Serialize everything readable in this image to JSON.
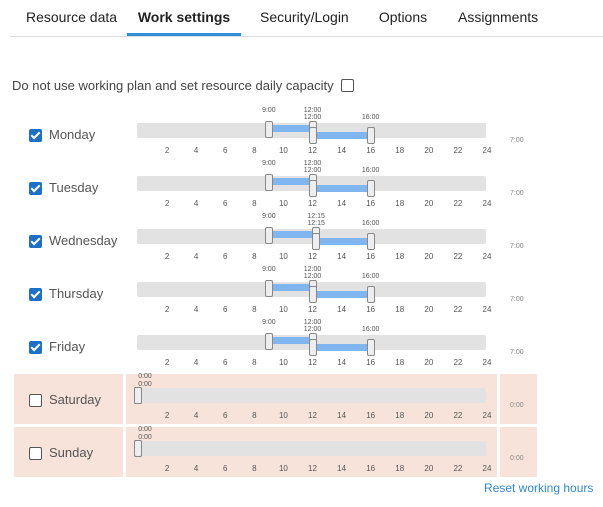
{
  "tabs": [
    {
      "label": "Resource data"
    },
    {
      "label": "Work settings",
      "active": true
    },
    {
      "label": "Security/Login"
    },
    {
      "label": "Options"
    },
    {
      "label": "Assignments"
    }
  ],
  "capacity_toggle": {
    "label": "Do not use working plan and set resource daily capacity",
    "checked": false
  },
  "ticks": [
    "2",
    "4",
    "6",
    "8",
    "10",
    "12",
    "14",
    "16",
    "18",
    "20",
    "22",
    "24"
  ],
  "days": [
    {
      "name": "Monday",
      "checked": true,
      "total": "7:00",
      "handles": [
        {
          "label": "9:00",
          "hour": 9
        },
        {
          "label": "12:00",
          "hour": 12
        },
        {
          "label": "12:00",
          "hour": 12
        },
        {
          "label": "16:00",
          "hour": 16
        }
      ]
    },
    {
      "name": "Tuesday",
      "checked": true,
      "total": "7:00",
      "handles": [
        {
          "label": "9:00",
          "hour": 9
        },
        {
          "label": "12:00",
          "hour": 12
        },
        {
          "label": "12:00",
          "hour": 12
        },
        {
          "label": "16:00",
          "hour": 16
        }
      ]
    },
    {
      "name": "Wednesday",
      "checked": true,
      "total": "7:00",
      "handles": [
        {
          "label": "9:00",
          "hour": 9
        },
        {
          "label": "12:15",
          "hour": 12.25
        },
        {
          "label": "12:15",
          "hour": 12.25
        },
        {
          "label": "16:00",
          "hour": 16
        }
      ]
    },
    {
      "name": "Thursday",
      "checked": true,
      "total": "7:00",
      "handles": [
        {
          "label": "9:00",
          "hour": 9
        },
        {
          "label": "12:00",
          "hour": 12
        },
        {
          "label": "12:00",
          "hour": 12
        },
        {
          "label": "16:00",
          "hour": 16
        }
      ]
    },
    {
      "name": "Friday",
      "checked": true,
      "total": "7:00",
      "handles": [
        {
          "label": "9:00",
          "hour": 9
        },
        {
          "label": "12:00",
          "hour": 12
        },
        {
          "label": "12:00",
          "hour": 12
        },
        {
          "label": "16:00",
          "hour": 16
        }
      ]
    },
    {
      "name": "Saturday",
      "checked": false,
      "total": "0:00",
      "handles": [
        {
          "label": "0:00",
          "hour": 0
        },
        {
          "label": "0:00",
          "hour": 0
        }
      ]
    },
    {
      "name": "Sunday",
      "checked": false,
      "total": "0:00",
      "handles": [
        {
          "label": "0:00",
          "hour": 0
        },
        {
          "label": "0:00",
          "hour": 0
        }
      ]
    }
  ],
  "reset_label": "Reset working hours",
  "colors": {
    "accent": "#2f8fd8",
    "range": "#7fb6f0",
    "disabled_bg": "#f8e3da",
    "checkbox": "#1d6fc7"
  }
}
